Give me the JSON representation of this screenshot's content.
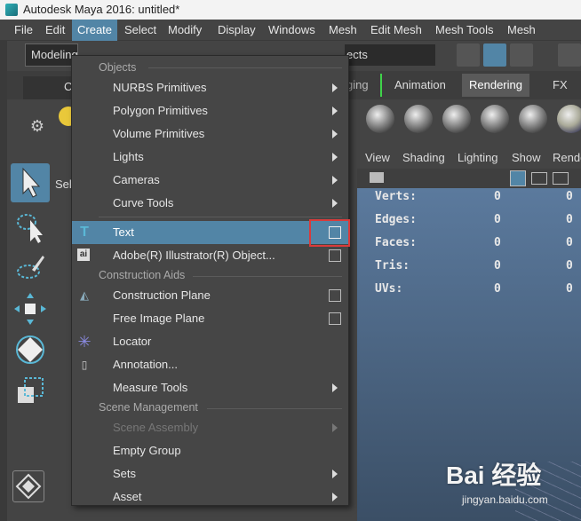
{
  "window": {
    "title": "Autodesk Maya 2016: untitled*"
  },
  "menubar": [
    "File",
    "Edit",
    "Create",
    "Select",
    "Modify",
    "Display",
    "Windows",
    "Mesh",
    "Edit Mesh",
    "Mesh Tools",
    "Mesh Display"
  ],
  "menubar_active": "Create",
  "toolbar": {
    "mode_value": "Modeling",
    "objects_value": "ects"
  },
  "shelf": {
    "tabs": [
      "ging",
      "Animation",
      "Rendering",
      "FX"
    ],
    "active": "Rendering",
    "left_tab": "C"
  },
  "toolbox": {
    "select_label": "Sele"
  },
  "viewport": {
    "menu": [
      "View",
      "Shading",
      "Lighting",
      "Show",
      "Rende"
    ],
    "hud": [
      {
        "label": "Verts:",
        "v1": "0",
        "v2": "0"
      },
      {
        "label": "Edges:",
        "v1": "0",
        "v2": "0"
      },
      {
        "label": "Faces:",
        "v1": "0",
        "v2": "0"
      },
      {
        "label": "Tris:",
        "v1": "0",
        "v2": "0"
      },
      {
        "label": "UVs:",
        "v1": "0",
        "v2": "0"
      }
    ]
  },
  "create_menu": {
    "sections": {
      "objects": "Objects",
      "construction": "Construction Aids",
      "scene": "Scene Management"
    },
    "items": [
      {
        "label": "NURBS Primitives"
      },
      {
        "label": "Polygon Primitives"
      },
      {
        "label": "Volume Primitives"
      },
      {
        "label": "Lights"
      },
      {
        "label": "Cameras"
      },
      {
        "label": "Curve Tools"
      },
      {
        "label": "Text"
      },
      {
        "label": "Adobe(R) Illustrator(R) Object..."
      },
      {
        "label": "Construction Plane"
      },
      {
        "label": "Free Image Plane"
      },
      {
        "label": "Locator"
      },
      {
        "label": "Annotation..."
      },
      {
        "label": "Measure Tools"
      },
      {
        "label": "Scene Assembly"
      },
      {
        "label": "Empty Group"
      },
      {
        "label": "Sets"
      },
      {
        "label": "Asset"
      }
    ],
    "highlighted": "Text"
  },
  "watermark": {
    "brand": "Bai 经验",
    "url": "jingyan.baidu.com"
  },
  "colors": {
    "accent": "#5285a6",
    "highlight_box": "#d93b3b",
    "rigging_marker": "#3fd34a"
  }
}
